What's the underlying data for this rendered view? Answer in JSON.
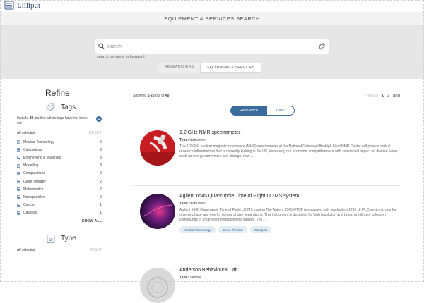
{
  "app": {
    "name": "Lilliput"
  },
  "header": {
    "title": "EQUIPMENT & SERVICES SEARCH"
  },
  "search": {
    "placeholder": "search",
    "hint": "search by name or keyword"
  },
  "tabs": [
    {
      "label": "RESEARCHERS",
      "active": false
    },
    {
      "label": "EQUIPMENT & SERVICES",
      "active": true
    }
  ],
  "sidebar": {
    "refine": "Refine",
    "tags_title": "Tags",
    "include_prefix": "Include ",
    "include_count": "28",
    "include_suffix": " profiles where tags have not been set",
    "all_selected": "All selected",
    "reset": "RESET",
    "items": [
      {
        "label": "Medical Technology",
        "count": "6"
      },
      {
        "label": "Calculations",
        "count": "3"
      },
      {
        "label": "Engineering & Materials",
        "count": "3"
      },
      {
        "label": "Modelling",
        "count": "3"
      },
      {
        "label": "Computations",
        "count": "2"
      },
      {
        "label": "Gene Therapy",
        "count": "2"
      },
      {
        "label": "Mathematics",
        "count": "2"
      },
      {
        "label": "Nanoparticles",
        "count": "2"
      },
      {
        "label": "Cancer",
        "count": "1"
      },
      {
        "label": "Catalysis",
        "count": "1"
      }
    ],
    "show_all": "SHOW ALL",
    "type_title": "Type",
    "type_all_selected": "All selected",
    "type_reset": "RESET"
  },
  "results": {
    "showing_prefix": "Showing ",
    "showing_range": "1-25",
    "showing_mid": " out of ",
    "showing_total": "40",
    "previous": "Previous",
    "pages": [
      "1",
      "2"
    ],
    "next": "Next",
    "sort_relevance": "Relevance",
    "sort_title": "Title ^",
    "type_label": "Type:",
    "cards": [
      {
        "title": "1.2 GHz NMR spectrometer",
        "type": "Instrument",
        "desc": "The 1.2 GHz nuclear magnetic resonance (NMR) spectrometer at the National Gateway Ultrahigh Field NMR Center will provide critical research infrastructure that is currently lacking in the US, increasing our economic competitiveness with substantial impact on diverse areas, such as energy conversion and storage; new…",
        "chips": []
      },
      {
        "title": "Agilent 6545 Quadrupole Time of Flight LC-MS system",
        "type": "Instrument",
        "desc": "Agilent 6545 Quadrupole Time of Flight LC-MS system The Agilent 6545 QTOF is equipped with two Agilent 1290 UHPLC systems, one for reverse phase and one for normal phase separations. This instrument is designed for high resolution and broad profiling of unknown compounds in untargeted metabolomics studies. The…",
        "chips": [
          "Medical Technology",
          "Gene Therapy",
          "Catalysis"
        ]
      },
      {
        "title": "Anderson Behavioural Lab",
        "type": "Service",
        "desc": "",
        "chips": []
      }
    ]
  },
  "colors": {
    "accent": "#3a6d9e",
    "hero_bg": "#e6e6e6",
    "chip_bg": "#e3ebf3"
  }
}
